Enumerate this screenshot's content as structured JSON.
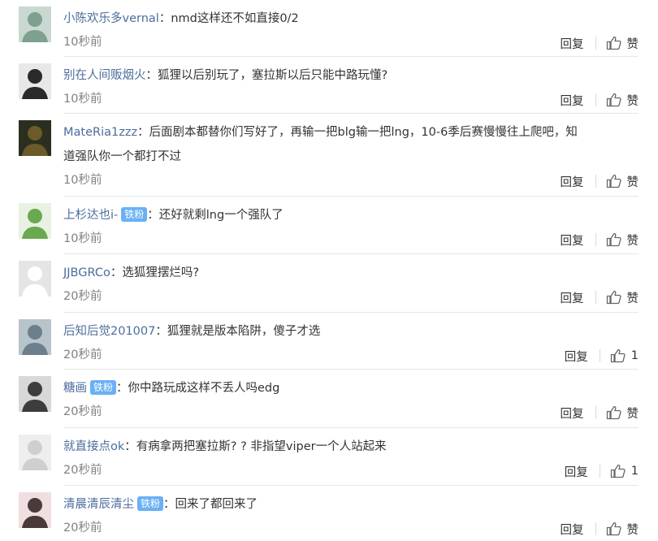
{
  "labels": {
    "reply": "回复",
    "like": "赞"
  },
  "comments": [
    {
      "user": "小陈欢乐多vernal",
      "badge": "",
      "text": "nmd这样还不如直接0/2",
      "text2": "",
      "time": "10秒前",
      "likes": "赞"
    },
    {
      "user": "别在人间贩烟火",
      "badge": "",
      "text": "狐狸以后别玩了，塞拉斯以后只能中路玩懂?",
      "text2": "",
      "time": "10秒前",
      "likes": "赞"
    },
    {
      "user": "MateRia1zzz",
      "badge": "",
      "text": "后面剧本都替你们写好了，再输一把blg输一把lng，10-6季后赛慢慢往上爬吧，知",
      "text2": "道强队你一个都打不过",
      "time": "10秒前",
      "likes": "赞"
    },
    {
      "user": "上杉达也i-",
      "badge": "铁粉",
      "text": "还好就剩lng一个强队了",
      "text2": "",
      "time": "10秒前",
      "likes": "赞"
    },
    {
      "user": "JJBGRCo",
      "badge": "",
      "text": "选狐狸摆烂吗?",
      "text2": "",
      "time": "20秒前",
      "likes": "赞"
    },
    {
      "user": "后知后觉201007",
      "badge": "",
      "text": "狐狸就是版本陷阱，傻子才选",
      "text2": "",
      "time": "20秒前",
      "likes": "1"
    },
    {
      "user": "糖画",
      "badge": "铁粉",
      "text": "你中路玩成这样不丢人吗edg",
      "text2": "",
      "time": "20秒前",
      "likes": "赞"
    },
    {
      "user": "就直接点ok",
      "badge": "",
      "text": "有病拿两把塞拉斯? ? 非指望viper一个人站起来",
      "text2": "",
      "time": "20秒前",
      "likes": "1"
    },
    {
      "user": "清晨清辰清尘",
      "badge": "铁粉",
      "text": "回来了都回来了",
      "text2": "",
      "time": "20秒前",
      "likes": "赞"
    }
  ]
}
